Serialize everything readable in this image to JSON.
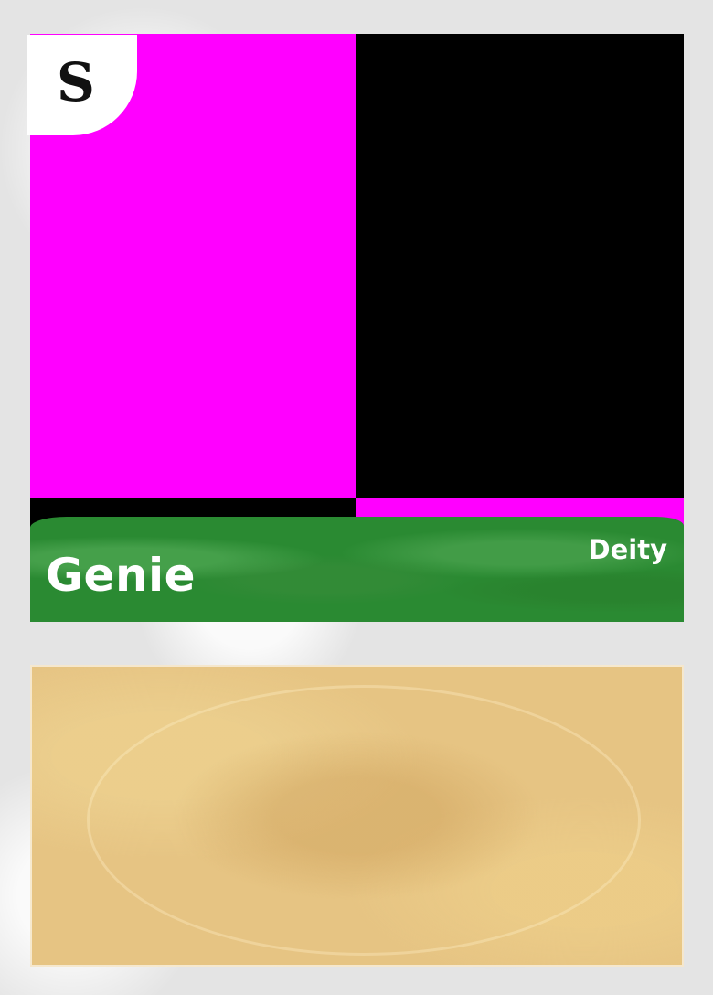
{
  "card": {
    "rarity_symbol": "S",
    "name": "Genie",
    "type": "Deity",
    "text": ""
  },
  "art": {
    "colors": {
      "top_left": "#ff00ff",
      "top_right": "#000000",
      "bottom_left": "#000000",
      "bottom_right": "#ff00ff"
    }
  },
  "palette": {
    "name_band": "#2a8a32",
    "text_box": "#e6c483",
    "frame": "#e4e4e4"
  }
}
